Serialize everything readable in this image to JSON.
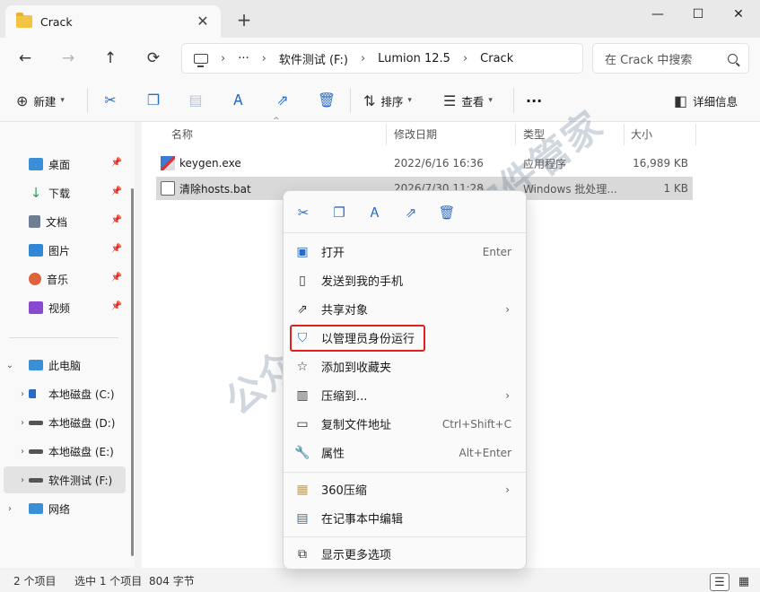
{
  "window": {
    "tab_title": "Crack",
    "tab_close": "✕",
    "new_tab": "+",
    "minimize": "—",
    "maximize": "☐",
    "close": "✕"
  },
  "nav": {
    "back": "←",
    "forward": "→",
    "up": "↑",
    "refresh": "⟳"
  },
  "address": {
    "more": "···",
    "crumbs": [
      "软件测试 (F:)",
      "Lumion 12.5",
      "Crack"
    ],
    "sep": "›",
    "search_placeholder": "在 Crack 中搜索"
  },
  "toolbar": {
    "new_label": "新建",
    "sort_label": "排序",
    "view_label": "查看",
    "more": "···",
    "details_label": "详细信息"
  },
  "sidebar": {
    "quick": [
      {
        "label": "桌面",
        "icon": "desktop-icon",
        "color": "#3a8fd8"
      },
      {
        "label": "下载",
        "icon": "download-icon",
        "color": "#2f9e5a"
      },
      {
        "label": "文档",
        "icon": "document-icon",
        "color": "#6d7f95"
      },
      {
        "label": "图片",
        "icon": "pictures-icon",
        "color": "#2f87d6"
      },
      {
        "label": "音乐",
        "icon": "music-icon",
        "color": "#e0623a"
      },
      {
        "label": "视频",
        "icon": "video-icon",
        "color": "#8a4ad0"
      }
    ],
    "pc_label": "此电脑",
    "drives": [
      {
        "label": "本地磁盘 (C:)"
      },
      {
        "label": "本地磁盘 (D:)"
      },
      {
        "label": "本地磁盘 (E:)"
      },
      {
        "label": "软件测试 (F:)"
      }
    ],
    "network_label": "网络"
  },
  "columns": {
    "name": "名称",
    "date": "修改日期",
    "type": "类型",
    "size": "大小"
  },
  "files": [
    {
      "name": "keygen.exe",
      "date": "2022/6/16 16:36",
      "type": "应用程序",
      "size": "16,989 KB"
    },
    {
      "name": "清除hosts.bat",
      "date": "2026/7/30 11:28",
      "type": "Windows 批处理...",
      "size": "1 KB"
    }
  ],
  "status": {
    "count": "2 个项目",
    "selected": "选中 1 个项目",
    "bytes": "804 字节"
  },
  "context_menu": {
    "items": [
      {
        "label": "打开",
        "shortcut": "Enter",
        "icon": "open-icon"
      },
      {
        "label": "发送到我的手机",
        "shortcut": "",
        "icon": "phone-icon"
      },
      {
        "label": "共享对象",
        "shortcut": "",
        "icon": "share-icon",
        "submenu": true
      },
      {
        "label": "以管理员身份运行",
        "shortcut": "",
        "icon": "shield-icon"
      },
      {
        "label": "添加到收藏夹",
        "shortcut": "",
        "icon": "star-icon"
      },
      {
        "label": "压缩到...",
        "shortcut": "",
        "icon": "zip-icon",
        "submenu": true
      },
      {
        "label": "复制文件地址",
        "shortcut": "Ctrl+Shift+C",
        "icon": "copy-path-icon"
      },
      {
        "label": "属性",
        "shortcut": "Alt+Enter",
        "icon": "wrench-icon"
      },
      {
        "label": "360压缩",
        "shortcut": "",
        "icon": "360zip-icon",
        "submenu": true
      },
      {
        "label": "在记事本中编辑",
        "shortcut": "",
        "icon": "notepad-icon"
      },
      {
        "label": "显示更多选项",
        "shortcut": "",
        "icon": "more-options-icon"
      }
    ],
    "arrow": "›"
  },
  "watermark": "公众号:莫莫 悠悠软件管家"
}
